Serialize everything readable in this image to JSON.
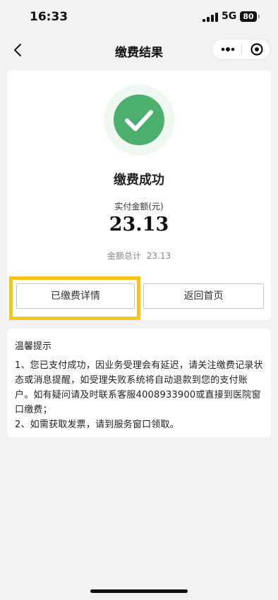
{
  "status_bar": {
    "time": "16:33",
    "network": "5G",
    "battery": "80"
  },
  "nav": {
    "title": "缴费结果",
    "back_icon": "chevron-left-icon",
    "more_icon": "more-dots-icon",
    "close_icon": "miniprogram-close-icon"
  },
  "result": {
    "status_icon": "check-circle-icon",
    "status_color": "#4caf6e",
    "title": "缴费成功",
    "amount_label": "实付金额(元)",
    "amount": "23.13",
    "total_label": "金额总计",
    "total_value": "23.13",
    "buttons": {
      "detail": "已缴费详情",
      "home": "返回首页"
    }
  },
  "tips": {
    "title": "温馨提示",
    "items": [
      "1、您已支付成功，因业务受理会有延迟，请关注缴费记录状态或消息提醒，如受理失败系统将自动退款到您的支付账户。如有疑问请及时联系客服4008933900或直接到医院窗口缴费；",
      "2、如需获取发票，请到服务窗口领取。"
    ]
  },
  "highlight_color": "#f5c518"
}
